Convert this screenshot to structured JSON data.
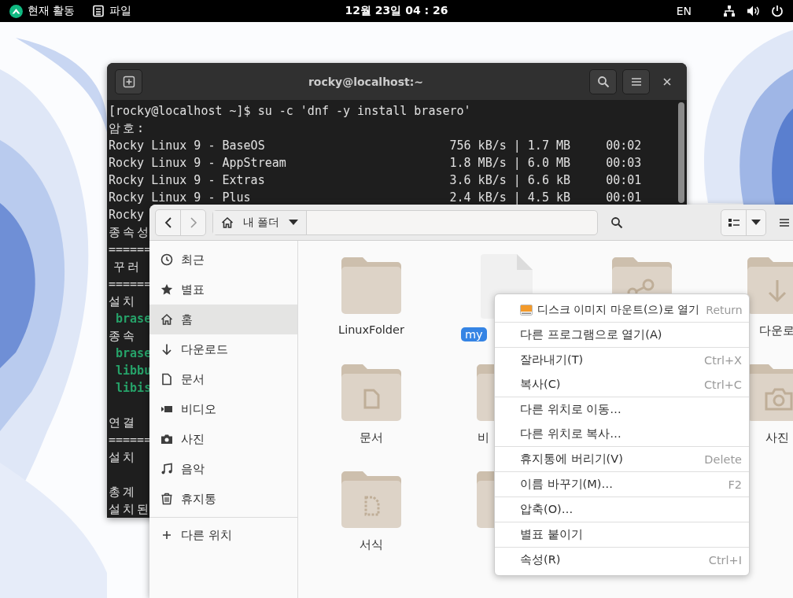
{
  "top_bar": {
    "activities": "현재 활동",
    "app": "파일",
    "clock": "12월 23일 04 : 26",
    "input_method": "EN"
  },
  "terminal": {
    "title": "rocky@localhost:~",
    "lines": [
      {
        "kind": "latin",
        "text": "[rocky@localhost ~]$ su -c 'dnf -y install brasero'"
      },
      {
        "kind": "hangul",
        "text": "암 호 :"
      },
      {
        "kind": "latin",
        "text": "Rocky Linux 9 - BaseOS                          756 kB/s | 1.7 MB     00:02"
      },
      {
        "kind": "latin",
        "text": "Rocky Linux 9 - AppStream                       1.8 MB/s | 6.0 MB     00:03"
      },
      {
        "kind": "latin",
        "text": "Rocky Linux 9 - Extras                          3.6 kB/s | 6.6 kB     00:01"
      },
      {
        "kind": "latin",
        "text": "Rocky Linux 9 - Plus                            2.4 kB/s | 4.5 kB     00:01"
      },
      {
        "kind": "latin",
        "text": "Rocky"
      },
      {
        "kind": "hangul",
        "text": "종 속 성"
      },
      {
        "kind": "latin",
        "text": "======"
      },
      {
        "kind": "hangul",
        "text": " 꾸 러"
      },
      {
        "kind": "latin",
        "text": "======"
      },
      {
        "kind": "hangul",
        "text": "설 치"
      },
      {
        "kind": "green",
        "text": " brase"
      },
      {
        "kind": "hangul",
        "text": "종 속"
      },
      {
        "kind": "green",
        "text": " brase"
      },
      {
        "kind": "green",
        "text": " libbu"
      },
      {
        "kind": "green",
        "text": " libis"
      },
      {
        "kind": "blank"
      },
      {
        "kind": "hangul",
        "text": "연 결"
      },
      {
        "kind": "latin",
        "text": "======"
      },
      {
        "kind": "hangul",
        "text": "설 치"
      },
      {
        "kind": "blank"
      },
      {
        "kind": "hangul",
        "text": "총 계"
      },
      {
        "kind": "hangul",
        "text": "설 치 된"
      }
    ]
  },
  "files": {
    "location": "내 폴더",
    "sidebar": [
      {
        "label": "최근",
        "selected": false
      },
      {
        "label": "별표",
        "selected": false
      },
      {
        "label": "홈",
        "selected": true
      },
      {
        "label": "다운로드",
        "selected": false
      },
      {
        "label": "문서",
        "selected": false
      },
      {
        "label": "비디오",
        "selected": false
      },
      {
        "label": "사진",
        "selected": false
      },
      {
        "label": "음악",
        "selected": false
      },
      {
        "label": "휴지통",
        "selected": false
      }
    ],
    "other_locations": "다른 위치",
    "items": [
      {
        "kind": "folder",
        "label": "LinuxFolder",
        "selected": false
      },
      {
        "kind": "file",
        "label": "my",
        "selected": true
      },
      {
        "kind": "share_folder"
      },
      {
        "kind": "download_folder",
        "label": "다운로",
        "selected": false
      },
      {
        "kind": "document_folder",
        "label": "문서",
        "selected": false
      },
      {
        "kind": "video_folder",
        "label": "비",
        "selected": false
      },
      {
        "kind": "picture_folder",
        "label": "사진",
        "selected": false
      },
      {
        "kind": "template_folder",
        "label": "서식",
        "selected": false
      },
      {
        "kind": "music_folder"
      }
    ]
  },
  "context_menu": {
    "groups": [
      [
        {
          "kind": "with_icon",
          "label": "디스크 이미지 마운트(으)로 열기",
          "shortcut": "Return"
        }
      ],
      [
        {
          "kind": "plain",
          "label": "다른 프로그램으로 열기(A)"
        }
      ],
      [
        {
          "kind": "plain",
          "label": "잘라내기(T)",
          "shortcut": "Ctrl+X"
        },
        {
          "kind": "plain",
          "label": "복사(C)",
          "shortcut": "Ctrl+C"
        }
      ],
      [
        {
          "kind": "plain",
          "label": "다른 위치로 이동…"
        },
        {
          "kind": "plain",
          "label": "다른 위치로 복사…"
        }
      ],
      [
        {
          "kind": "plain",
          "label": "휴지통에 버리기(V)",
          "shortcut": "Delete"
        }
      ],
      [
        {
          "kind": "plain",
          "label": "이름 바꾸기(M)…",
          "shortcut": "F2"
        }
      ],
      [
        {
          "kind": "plain",
          "label": "압축(O)…"
        }
      ],
      [
        {
          "kind": "plain",
          "label": "별표 붙이기"
        }
      ],
      [
        {
          "kind": "plain",
          "label": "속성(R)",
          "shortcut": "Ctrl+I"
        }
      ]
    ]
  }
}
